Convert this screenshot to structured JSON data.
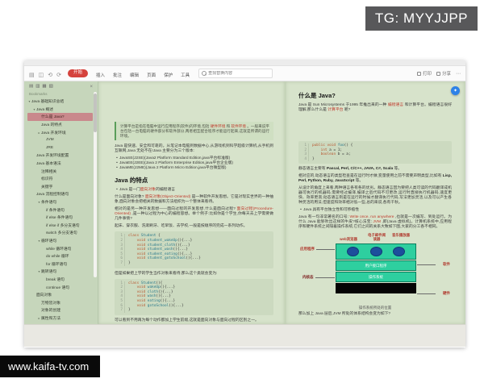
{
  "watermarks": {
    "tg": "TG: MYYJJPP",
    "site": "www.kaifa-tv.com"
  },
  "toolbar": {
    "left_icons": [
      {
        "name": "sidebar-toggle-icon",
        "glyph": "▤"
      },
      {
        "name": "save-icon",
        "glyph": "◫"
      },
      {
        "name": "undo-icon",
        "glyph": "⟲"
      },
      {
        "name": "redo-icon",
        "glyph": "⟳"
      }
    ],
    "start_tab": "开始",
    "tabs": [
      "插入",
      "批注",
      "编辑",
      "页面",
      "保护",
      "工具"
    ],
    "search_placeholder": "查找替换内容",
    "right_buttons": [
      "打印",
      "分享"
    ],
    "more_glyph": "⋯"
  },
  "sidebar": {
    "header_icons": [
      {
        "name": "toc-panel-icon",
        "glyph": "▤"
      },
      {
        "name": "bookmark-panel-icon",
        "glyph": "▥"
      },
      {
        "name": "thumbnail-panel-icon",
        "glyph": "▦"
      },
      {
        "name": "annotation-panel-icon",
        "glyph": "▧"
      }
    ],
    "close_glyph": "×",
    "header": "Bookmarks",
    "bullet": "•",
    "items": [
      {
        "label": "Java 基础知识总结",
        "level": 0,
        "caret": "▾"
      },
      {
        "label": "Java 概述",
        "level": 1,
        "caret": "▾"
      },
      {
        "label": "什么是 Java?",
        "level": 2,
        "active": true
      },
      {
        "label": "Java 的特点",
        "level": 2
      },
      {
        "label": "Java 开发环境",
        "level": 2,
        "caret": "▸"
      },
      {
        "label": "JVM",
        "level": 3
      },
      {
        "label": "JRE",
        "level": 3
      },
      {
        "label": "Java 开发环境配置",
        "level": 1
      },
      {
        "label": "Java 基本语法",
        "level": 1
      },
      {
        "label": "注释相关",
        "level": 2
      },
      {
        "label": "标识符",
        "level": 2
      },
      {
        "label": "关键字",
        "level": 2
      },
      {
        "label": "Java 流程控制语句",
        "level": 1
      },
      {
        "label": "条件语句",
        "level": 2,
        "caret": "▾"
      },
      {
        "label": "if 条件语句",
        "level": 3
      },
      {
        "label": "if else 条件语句",
        "level": 3
      },
      {
        "label": "if else if 多分支语句",
        "level": 3
      },
      {
        "label": "switch 多分支语句",
        "level": 3
      },
      {
        "label": "循环语句",
        "level": 2,
        "caret": "▾"
      },
      {
        "label": "while 循环语句",
        "level": 3
      },
      {
        "label": "do while 循环",
        "level": 3
      },
      {
        "label": "for 循环语句",
        "level": 3
      },
      {
        "label": "跳转语句",
        "level": 2,
        "caret": "▾"
      },
      {
        "label": "break 语句",
        "level": 3
      },
      {
        "label": "continue 语句",
        "level": 3
      },
      {
        "label": "面向对象",
        "level": 1
      },
      {
        "label": "万物皆对象",
        "level": 2
      },
      {
        "label": "对象的创建",
        "level": 2
      },
      {
        "label": "属性和方法",
        "level": 2,
        "caret": "▸"
      }
    ]
  },
  "left_page": {
    "blocks": [
      {
        "type": "quote",
        "spans": [
          {
            "t": "计算平台是指在电脑中运行应用程序(软件)的环境,包括 "
          },
          {
            "t": "硬件环境",
            "hl": true
          },
          {
            "t": " 和 "
          },
          {
            "t": "软件环境",
            "hl": true
          },
          {
            "t": " 。一般来说平台包括一台电脑的硬件部分和软件部分,两者相互配合程序才能运行起来,这就是所谓的运行环境。"
          }
        ]
      },
      {
        "type": "p",
        "spans": [
          {
            "t": "Java 是快速、安全和可靠的。从笔记本电脑到数据中心,从游戏机到科学超级计算机,从手机到互联网,Java 无处不在!Java 主要分为三个版本:"
          }
        ]
      },
      {
        "type": "ul",
        "items": [
          [
            {
              "t": "JavaSE(J2SE)(Java2 Platform Standard Edition,java平台标准版)"
            }
          ],
          [
            {
              "t": "JavaEE(J2EE)(Java 2 Platform Enterprise Edition,java平台企业版)"
            }
          ],
          [
            {
              "t": "JavaME(J2ME)(Java 2 Platform Micro Edition,java平台微型版)"
            }
          ]
        ]
      },
      {
        "type": "h2",
        "text": "Java 的特点"
      },
      {
        "type": "ul",
        "items": [
          [
            {
              "t": "Java 是一门 "
            },
            {
              "t": "面向对象",
              "hl": true
            },
            {
              "t": " 的编程语言"
            }
          ]
        ]
      },
      {
        "type": "p",
        "spans": [
          {
            "t": "什么是面向对象? "
          },
          {
            "t": "面向对象(Object-Oriented)",
            "hl": true
          },
          {
            "t": " 是一种软件开发思想。它是对现实世界的一种抽象,面向对象会把相关的数据和方法组织为一个整体来看待。"
          }
        ]
      },
      {
        "type": "p",
        "spans": [
          {
            "t": "相对的是另一种开发思想——面向过程的开发思想,什么是面向过程? "
          },
          {
            "t": "面向过程(Procedure-Oriented)",
            "hl": true
          },
          {
            "t": " ,是一种以过程为中心的编程思想。举个例子:比如你是个学生,你每天去上学需要做几件事情?"
          }
        ]
      },
      {
        "type": "p",
        "spans": [
          {
            "t": "起床、穿衣服、洗漱刷牙、吃早饭、去学校,一般是按顺序的完成一系列动作。"
          }
        ]
      },
      {
        "type": "code",
        "lines": [
          [
            {
              "t": "class ",
              "c": "k"
            },
            {
              "t": "Student",
              "c": "n"
            },
            {
              "t": " {"
            }
          ],
          [
            {
              "t": "    "
            },
            {
              "t": "void",
              "c": "k"
            },
            {
              "t": " student_wakeUp",
              "c": "n"
            },
            {
              "t": "(){...}"
            }
          ],
          [
            {
              "t": "    "
            },
            {
              "t": "void",
              "c": "k"
            },
            {
              "t": " student_cloth",
              "c": "n"
            },
            {
              "t": "(){...}"
            }
          ],
          [
            {
              "t": "    "
            },
            {
              "t": "void",
              "c": "k"
            },
            {
              "t": " student_wash",
              "c": "n"
            },
            {
              "t": "(){...}"
            }
          ],
          [
            {
              "t": "    "
            },
            {
              "t": "void",
              "c": "k"
            },
            {
              "t": " student_eating",
              "c": "n"
            },
            {
              "t": "(){...}"
            }
          ],
          [
            {
              "t": "    "
            },
            {
              "t": "void",
              "c": "k"
            },
            {
              "t": " student_gotoSchool",
              "c": "n"
            },
            {
              "t": "(){...}"
            }
          ],
          [
            {
              "t": "}"
            }
          ]
        ]
      },
      {
        "type": "p",
        "spans": [
          {
            "t": "但是如果把上学的学生当作对象来看待,那么这个类就会变为:"
          }
        ]
      },
      {
        "type": "code",
        "lines": [
          [
            {
              "t": "class ",
              "c": "k"
            },
            {
              "t": "Student",
              "c": "n"
            },
            {
              "t": "(){"
            }
          ],
          [
            {
              "t": "    "
            },
            {
              "t": "void",
              "c": "k"
            },
            {
              "t": " wakeUp",
              "c": "n"
            },
            {
              "t": "(){...}"
            }
          ],
          [
            {
              "t": "    "
            },
            {
              "t": "void",
              "c": "k"
            },
            {
              "t": " cloth",
              "c": "n"
            },
            {
              "t": "(){...}"
            }
          ],
          [
            {
              "t": "    "
            },
            {
              "t": "void",
              "c": "k"
            },
            {
              "t": " wash",
              "c": "n"
            },
            {
              "t": "(){...}"
            }
          ],
          [
            {
              "t": "    "
            },
            {
              "t": "void",
              "c": "k"
            },
            {
              "t": " eating",
              "c": "n"
            },
            {
              "t": "(){...}"
            }
          ],
          [
            {
              "t": "    "
            },
            {
              "t": "void",
              "c": "k"
            },
            {
              "t": " gotoSchool",
              "c": "n"
            },
            {
              "t": "(){...}"
            }
          ],
          [
            {
              "t": "}"
            }
          ]
        ]
      },
      {
        "type": "p",
        "spans": [
          {
            "t": "可以看到不用再为每个动作都加上学生前缀,这就是面向对象与面向过程的区别之一。"
          }
        ]
      }
    ]
  },
  "right_page": {
    "blocks_top": [
      {
        "type": "h2",
        "text": "什么是 Java?"
      },
      {
        "type": "p",
        "spans": [
          {
            "t": "Java 是 Sun Microsystems 于1995 年推出来的一种 "
          },
          {
            "t": "编程语言",
            "hl": true
          },
          {
            "t": " 和计算平台。编程语言很好理解,那么什么是 "
          },
          {
            "t": "计算平台",
            "hl": true
          },
          {
            "t": " 呢?"
          }
        ]
      },
      {
        "type": "spacer",
        "h": 30
      },
      {
        "type": "code",
        "lines": [
          [
            {
              "t": "public void ",
              "c": "k"
            },
            {
              "t": "foo",
              "c": "n"
            },
            {
              "t": "() {"
            }
          ],
          [
            {
              "t": "    "
            },
            {
              "t": "int",
              "c": "k"
            },
            {
              "t": " a = 1;"
            }
          ],
          [
            {
              "t": "    "
            },
            {
              "t": "boolean",
              "c": "k"
            },
            {
              "t": " b = a;"
            }
          ],
          [
            {
              "t": "}"
            }
          ]
        ]
      },
      {
        "type": "p",
        "spans": [
          {
            "t": "静态语言主要有 "
          },
          {
            "t": "Pascal, Perl, C/C++, JAVA, C#, Scala",
            "b": true
          },
          {
            "t": " 等。"
          }
        ]
      },
      {
        "type": "p",
        "spans": [
          {
            "t": "相对应的,动态语言的类型检查是在运行时才做,变量使用之前不需要声明类型,比如有 "
          },
          {
            "t": "Lisp, Perl, Python, Ruby, JavaScript",
            "b": true
          },
          {
            "t": " 等。"
          }
        ]
      },
      {
        "type": "p",
        "spans": [
          {
            "t": "从设计的角度上来看,两种语言各有各的优劣。静态语言因为要把人类可读的代码翻译成机器可执行的机器码,需要经过编译,编译之后代码不可更改,运行时直接执行机器码,速度更快、效率更高;动态语言则是在运行的时候才翻译执行代码,写法更加灵活,以及可以产生各种灵活的用法,但速度和效率相对低一些,总的来说,各有千秋。"
          }
        ]
      },
      {
        "type": "ul",
        "items": [
          [
            {
              "t": "Java 具有平台独立性和可移植性"
            }
          ]
        ]
      },
      {
        "type": "p",
        "spans": [
          {
            "t": "Java 有一句非常著名的口号: "
          },
          {
            "t": "Write once, run anywhere",
            "hl": true
          },
          {
            "t": " ,也就是一次编写、到处运行。为什么 Java 能够吹出这样的牛皮?核心法宝: "
          },
          {
            "t": "JVM",
            "hl": true
          },
          {
            "t": " ,即(Java 虚拟机)。计算机系统中,应用程序和硬件系统之间隔着操作系统,它们之间的关系大致如下图,大家的分工各不相同。"
          }
        ]
      }
    ],
    "caption": "操作系统所处的位置",
    "blocks_bottom": [
      {
        "type": "p",
        "spans": [
          {
            "t": "那么加上 Java 层后,JVM 所处的体系结构会变为如下?"
          }
        ]
      }
    ]
  },
  "diagram": {
    "top_labels": [
      "web浏览器",
      "电子邮件阅读器",
      "音乐播放器"
    ],
    "rows": [
      "用户接口程序",
      "操作系统"
    ],
    "left_labels": [
      "应用程序",
      "内核态"
    ],
    "right_labels": [
      "软件",
      "硬件"
    ],
    "caption": "操作系统所处的位置"
  }
}
